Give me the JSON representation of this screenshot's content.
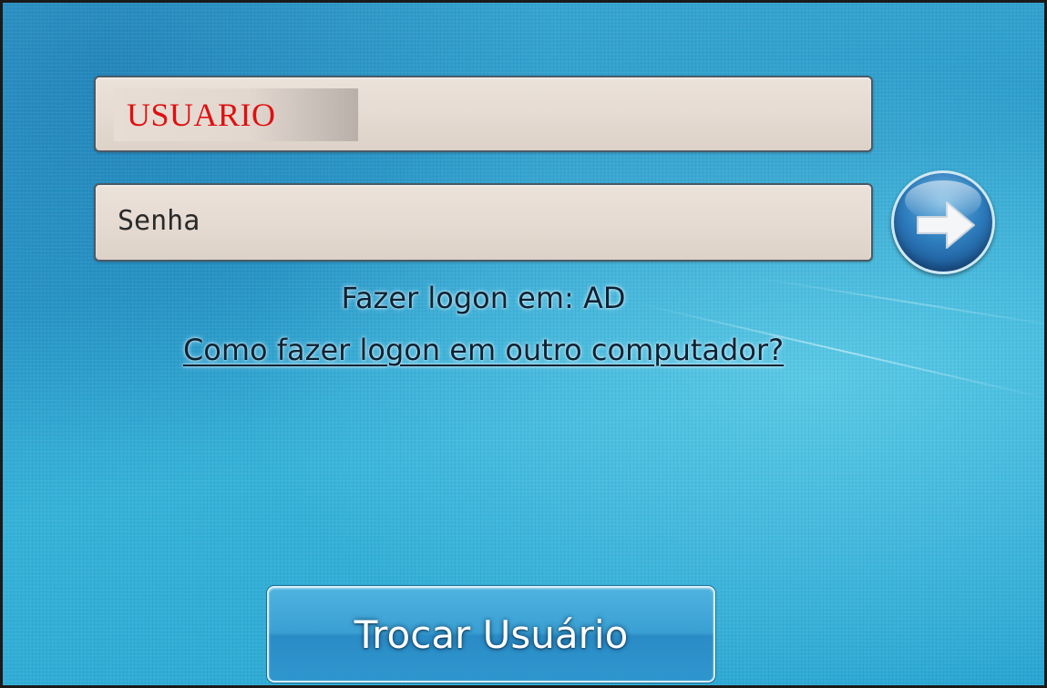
{
  "login": {
    "username_value": "USUARIO",
    "password_placeholder": "Senha",
    "domain_text": "Fazer logon em: AD",
    "help_link": "Como fazer logon em outro computador?",
    "switch_user_label": "Trocar Usuário"
  },
  "icons": {
    "submit": "arrow-right-icon"
  },
  "colors": {
    "background": "#2fa3d3",
    "username_text": "#e01010",
    "field_background": "#e6dbd2",
    "submit_button": "#2f7fbf"
  }
}
